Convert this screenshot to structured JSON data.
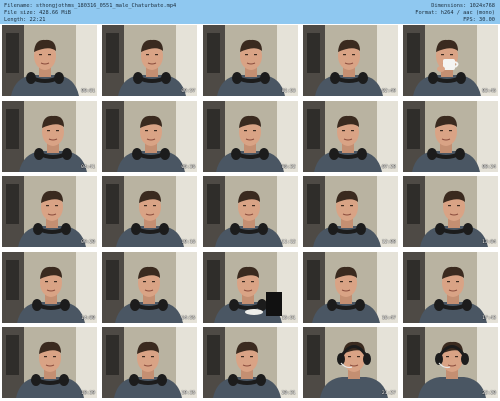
{
  "header": {
    "filename": "Filename: sthongjothms_180316_0551_male_Chaturbate.mp4",
    "filesize": "File size: 428.66 MiB",
    "length": "Length: 22:21",
    "dimensions": "Dimensions: 1024x768",
    "format": "Format: h264 / aac (mono)",
    "fps": "FPS: 30.00"
  },
  "colors": {
    "header_bg": "#8fc8f0",
    "wall": "#b9b3a1",
    "shirt": "#4a5663",
    "skin": "#d9a385",
    "hair": "#3a2a1f",
    "headphones": "#1c1c1c"
  },
  "thumbnails": [
    {
      "time": "00:01",
      "prop": "none"
    },
    {
      "time": "00:57",
      "prop": "none"
    },
    {
      "time": "01:53",
      "prop": "none"
    },
    {
      "time": "02:49",
      "prop": "none"
    },
    {
      "time": "03:45",
      "prop": "mug"
    },
    {
      "time": "04:41",
      "prop": "none"
    },
    {
      "time": "05:36",
      "prop": "none"
    },
    {
      "time": "06:32",
      "prop": "none"
    },
    {
      "time": "07:28",
      "prop": "none"
    },
    {
      "time": "08:24",
      "prop": "none"
    },
    {
      "time": "09:20",
      "prop": "none"
    },
    {
      "time": "10:16",
      "prop": "none"
    },
    {
      "time": "11:12",
      "prop": "none"
    },
    {
      "time": "12:08",
      "prop": "none"
    },
    {
      "time": "13:04",
      "prop": "none"
    },
    {
      "time": "14:00",
      "prop": "none"
    },
    {
      "time": "14:55",
      "prop": "none"
    },
    {
      "time": "15:51",
      "prop": "bowl"
    },
    {
      "time": "16:47",
      "prop": "none"
    },
    {
      "time": "17:43",
      "prop": "none"
    },
    {
      "time": "18:39",
      "prop": "none"
    },
    {
      "time": "19:35",
      "prop": "none"
    },
    {
      "time": "20:31",
      "prop": "none"
    },
    {
      "time": "21:27",
      "prop": "headset"
    },
    {
      "time": "22:20",
      "prop": "headset"
    }
  ]
}
